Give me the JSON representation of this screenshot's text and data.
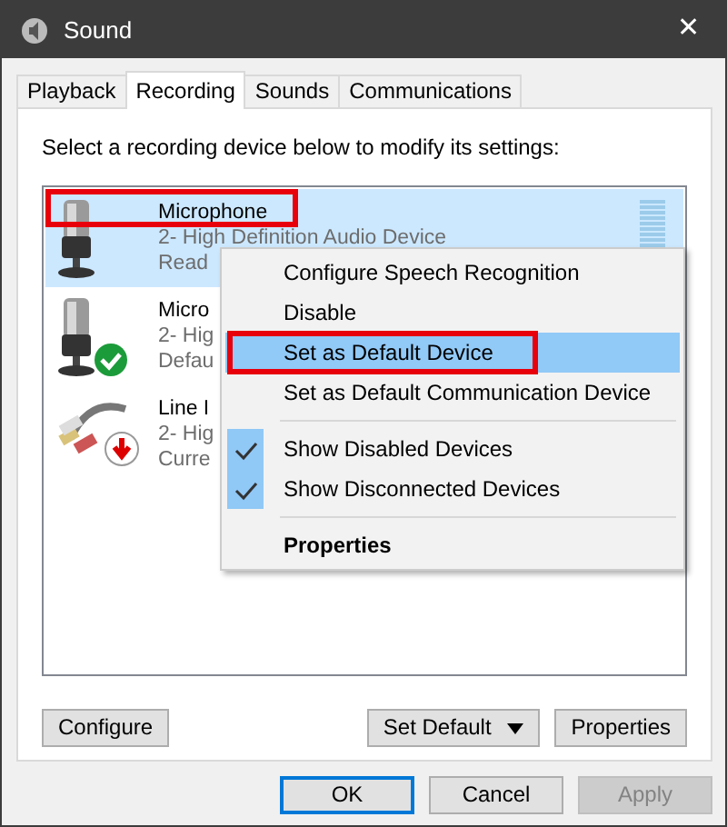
{
  "window": {
    "title": "Sound",
    "close": "✕"
  },
  "tabs": [
    {
      "label": "Playback",
      "selected": false
    },
    {
      "label": "Recording",
      "selected": true
    },
    {
      "label": "Sounds",
      "selected": false
    },
    {
      "label": "Communications",
      "selected": false
    }
  ],
  "instruction": "Select a recording device below to modify its settings:",
  "devices": [
    {
      "kind": "microphone",
      "name": "Microphone",
      "description": "2- High Definition Audio Device",
      "status": "Read",
      "selected": true,
      "annotated": true,
      "level": 0
    },
    {
      "kind": "default-microphone",
      "name": "Micro",
      "description": "2- Hig",
      "status": "Defau",
      "selected": false,
      "annotated": false
    },
    {
      "kind": "unplugged-line-in",
      "name": "Line I",
      "description": "2- Hig",
      "status": "Curre",
      "selected": false,
      "annotated": false
    }
  ],
  "context_menu": [
    {
      "kind": "item",
      "label": "Configure Speech Recognition",
      "selected": false,
      "checked": false,
      "annotated": false,
      "bold": false
    },
    {
      "kind": "item",
      "label": "Disable",
      "selected": false,
      "checked": false,
      "annotated": false,
      "bold": false
    },
    {
      "kind": "item",
      "label": "Set as Default Device",
      "selected": true,
      "checked": false,
      "annotated": true,
      "bold": false
    },
    {
      "kind": "item",
      "label": "Set as Default Communication Device",
      "selected": false,
      "checked": false,
      "annotated": false,
      "bold": false
    },
    {
      "kind": "separator"
    },
    {
      "kind": "item",
      "label": "Show Disabled Devices",
      "selected": false,
      "checked": true,
      "annotated": false,
      "bold": false
    },
    {
      "kind": "item",
      "label": "Show Disconnected Devices",
      "selected": false,
      "checked": true,
      "annotated": false,
      "bold": false
    },
    {
      "kind": "separator"
    },
    {
      "kind": "item",
      "label": "Properties",
      "selected": false,
      "checked": false,
      "annotated": false,
      "bold": true
    }
  ],
  "panel_buttons": [
    {
      "kind": "plain",
      "label": "Configure"
    },
    {
      "kind": "split",
      "label": "Set Default"
    },
    {
      "kind": "plain",
      "label": "Properties"
    }
  ],
  "dialog_buttons": [
    {
      "label": "OK",
      "default": true,
      "disabled": false
    },
    {
      "label": "Cancel",
      "default": false,
      "disabled": false
    },
    {
      "label": "Apply",
      "default": false,
      "disabled": true
    }
  ]
}
